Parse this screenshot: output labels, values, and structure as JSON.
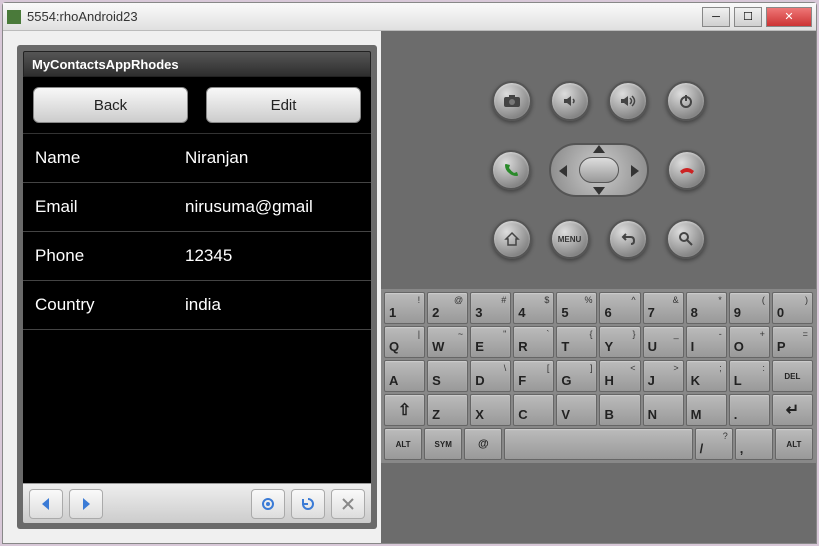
{
  "window": {
    "title": "5554:rhoAndroid23"
  },
  "app": {
    "title": "MyContactsAppRhodes",
    "buttons": {
      "back": "Back",
      "edit": "Edit"
    },
    "rows": [
      {
        "label": "Name",
        "value": "Niranjan"
      },
      {
        "label": "Email",
        "value": "nirusuma@gmail"
      },
      {
        "label": "Phone",
        "value": "12345"
      },
      {
        "label": "Country",
        "value": "india"
      }
    ]
  },
  "controls": {
    "menu_label": "MENU"
  },
  "keyboard": {
    "row1": [
      {
        "m": "1",
        "a": "!"
      },
      {
        "m": "2",
        "a": "@"
      },
      {
        "m": "3",
        "a": "#"
      },
      {
        "m": "4",
        "a": "$"
      },
      {
        "m": "5",
        "a": "%"
      },
      {
        "m": "6",
        "a": "^"
      },
      {
        "m": "7",
        "a": "&"
      },
      {
        "m": "8",
        "a": "*"
      },
      {
        "m": "9",
        "a": "("
      },
      {
        "m": "0",
        "a": ")"
      }
    ],
    "row2": [
      {
        "m": "Q",
        "a": "|"
      },
      {
        "m": "W",
        "a": "~"
      },
      {
        "m": "E",
        "a": "\""
      },
      {
        "m": "R",
        "a": "`"
      },
      {
        "m": "T",
        "a": "{"
      },
      {
        "m": "Y",
        "a": "}"
      },
      {
        "m": "U",
        "a": "_"
      },
      {
        "m": "I",
        "a": "-"
      },
      {
        "m": "O",
        "a": "+"
      },
      {
        "m": "P",
        "a": "="
      }
    ],
    "row3": [
      {
        "m": "A",
        "a": ""
      },
      {
        "m": "S",
        "a": ""
      },
      {
        "m": "D",
        "a": "\\"
      },
      {
        "m": "F",
        "a": "["
      },
      {
        "m": "G",
        "a": "]"
      },
      {
        "m": "H",
        "a": "<"
      },
      {
        "m": "J",
        "a": ">"
      },
      {
        "m": "K",
        "a": ";"
      },
      {
        "m": "L",
        "a": ":"
      },
      {
        "m": "DEL",
        "a": ""
      }
    ],
    "row4": [
      {
        "m": "⇧",
        "a": ""
      },
      {
        "m": "Z",
        "a": ""
      },
      {
        "m": "X",
        "a": ""
      },
      {
        "m": "C",
        "a": ""
      },
      {
        "m": "V",
        "a": ""
      },
      {
        "m": "B",
        "a": ""
      },
      {
        "m": "N",
        "a": ""
      },
      {
        "m": "M",
        "a": ""
      },
      {
        "m": ".",
        "a": ""
      },
      {
        "m": "↵",
        "a": ""
      }
    ],
    "row5": {
      "alt_l": "ALT",
      "sym": "SYM",
      "at": "@",
      "space": "",
      "slash": "/",
      "comma_q": ",",
      "alt_r": "ALT"
    }
  }
}
